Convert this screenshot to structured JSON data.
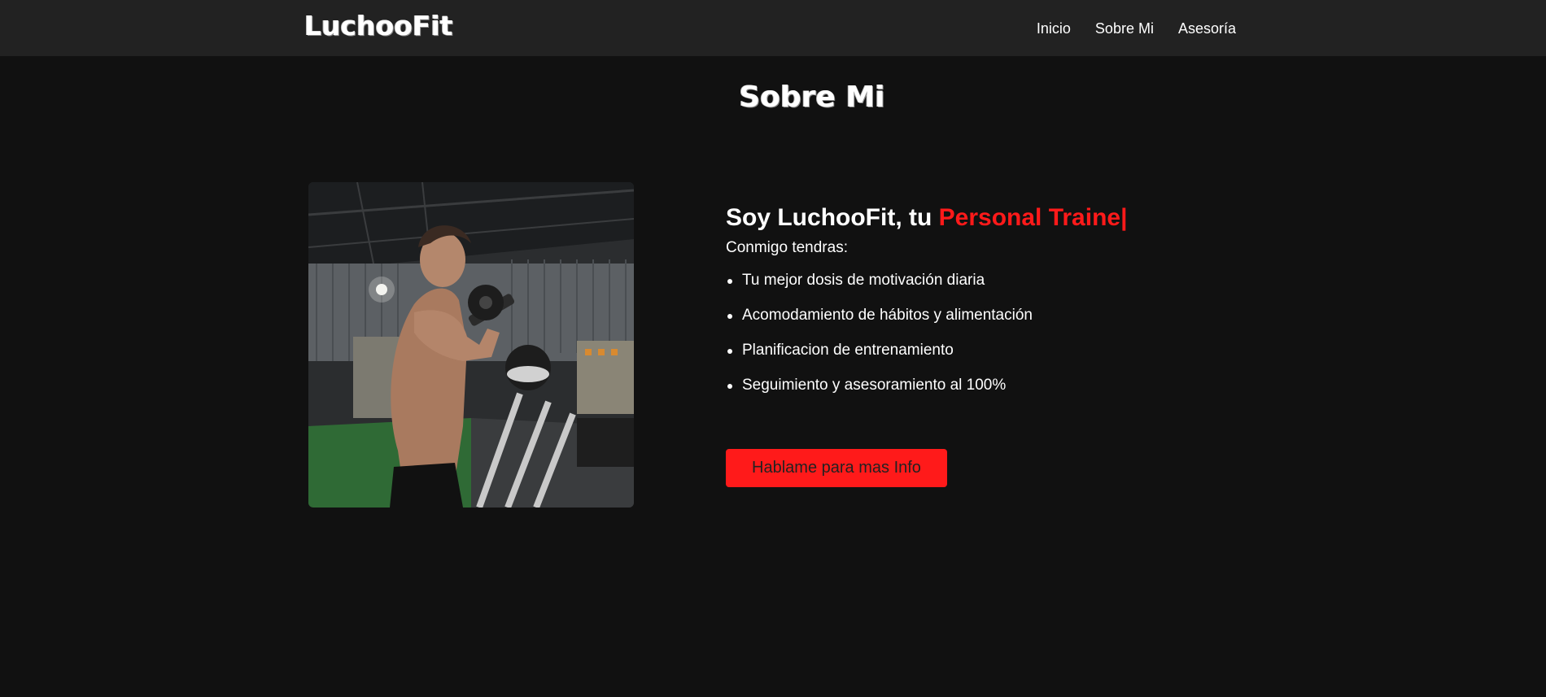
{
  "header": {
    "logo": "LuchooFit",
    "nav": [
      "Inicio",
      "Sobre Mi",
      "Asesoría"
    ]
  },
  "section": {
    "title": "Sobre Mi"
  },
  "about": {
    "headline_prefix": "Soy LuchooFit, tu ",
    "headline_accent": "Personal Traine|",
    "intro": "Conmigo tendras:",
    "features": [
      "Tu mejor dosis de motivación diaria",
      "Acomodamiento de hábitos y alimentación",
      "Planificacion de entrenamiento",
      "Seguimiento y asesoramiento al 100%"
    ],
    "cta_label": "Hablame para mas Info"
  },
  "colors": {
    "page_bg": "#111111",
    "nav_bg": "#222222",
    "accent": "#ff1a1a",
    "text": "#ffffff"
  }
}
